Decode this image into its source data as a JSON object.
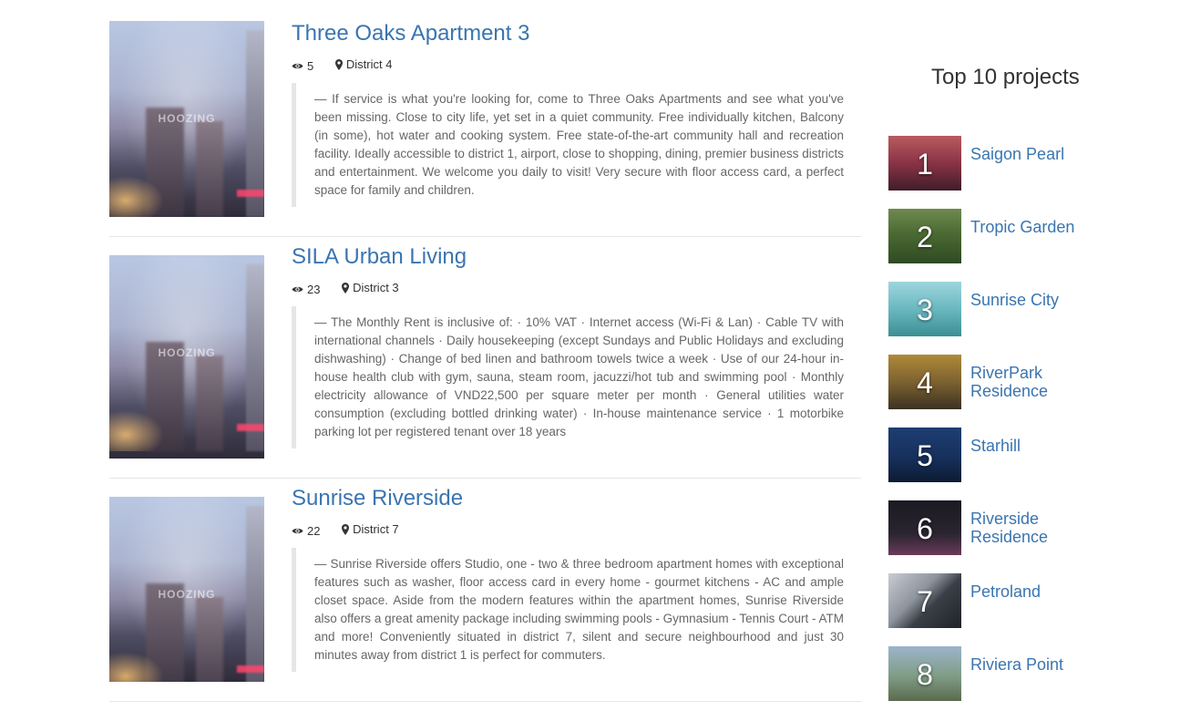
{
  "listings": [
    {
      "title": "Three Oaks Apartment 3",
      "views": "5",
      "district": "District 4",
      "thumb_watermark": "HOOZING",
      "description": "— If service is what you're looking for, come to Three Oaks Apartments and see what you've been missing. Close to city life, yet set in a quiet community. Free individually kitchen, Balcony (in some), hot water and cooking system. Free state-of-the-art community hall and recreation facility. Ideally accessible to district 1, airport, close to shopping, dining, premier business districts and entertainment. We welcome you daily to visit! Very secure with floor access card, a perfect space for family and children."
    },
    {
      "title": "SILA Urban Living",
      "views": "23",
      "district": "District 3",
      "thumb_watermark": "HOOZING",
      "description": "— The Monthly Rent is inclusive of: · 10% VAT · Internet access (Wi-Fi & Lan) · Cable TV with international channels · Daily housekeeping (except Sundays and Public Holidays and excluding dishwashing) · Change of bed linen and bathroom towels twice a week · Use of our 24-hour in-house health club with gym, sauna, steam room, jacuzzi/hot tub and swimming pool · Monthly electricity allowance of VND22,500 per square meter per month · General utilities water consumption (excluding bottled drinking water) · In-house maintenance service · 1 motorbike parking lot per registered tenant over 18 years"
    },
    {
      "title": "Sunrise Riverside",
      "views": "22",
      "district": "District 7",
      "thumb_watermark": "HOOZING",
      "description": "— Sunrise Riverside offers Studio, one - two & three bedroom apartment homes with exceptional features such as washer, floor access card in every home - gourmet kitchens - AC and ample closet space. Aside from the modern features within the apartment homes, Sunrise Riverside also offers a great amenity package including swimming pools - Gymnasium - Tennis Court - ATM and more! Conveniently situated in district 7, silent and secure neighbourhood and just 30 minutes away from district 1 is perfect for commuters."
    }
  ],
  "sidebar": {
    "title": "Top 10 projects",
    "projects": [
      {
        "rank": "1",
        "name": "Saigon Pearl"
      },
      {
        "rank": "2",
        "name": "Tropic Garden"
      },
      {
        "rank": "3",
        "name": "Sunrise City"
      },
      {
        "rank": "4",
        "name": "RiverPark Residence"
      },
      {
        "rank": "5",
        "name": "Starhill"
      },
      {
        "rank": "6",
        "name": "Riverside Residence"
      },
      {
        "rank": "7",
        "name": "Petroland"
      },
      {
        "rank": "8",
        "name": "Riviera Point"
      }
    ]
  },
  "colors": {
    "link": "#3a75b0",
    "divider": "#e6e6e6",
    "quote_border": "#e6e6e6"
  },
  "icons": {
    "views": "eye-icon",
    "location": "map-marker-icon"
  }
}
